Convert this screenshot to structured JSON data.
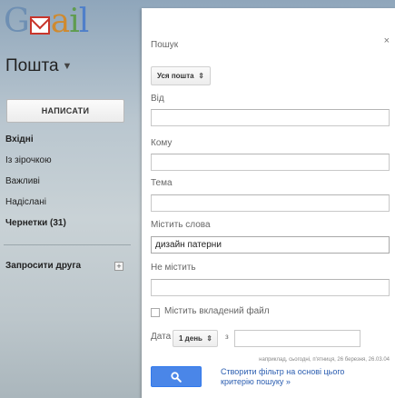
{
  "app": {
    "logo_text": "Gmail"
  },
  "sidebar": {
    "mail_switch_label": "Пошта",
    "compose_label": "НАПИСАТИ",
    "items": [
      {
        "label": "Вхідні",
        "bold": true
      },
      {
        "label": "Із зірочкою",
        "bold": false
      },
      {
        "label": "Важливі",
        "bold": false
      },
      {
        "label": "Надіслані",
        "bold": false
      },
      {
        "label": "Чернетки (31)",
        "bold": true
      }
    ],
    "invite_label": "Запросити друга",
    "invite_plus": "+"
  },
  "search_panel": {
    "close_glyph": "×",
    "search_label": "Пошук",
    "scope_value": "Уся пошта",
    "from_label": "Від",
    "from_value": "",
    "to_label": "Кому",
    "to_value": "",
    "subject_label": "Тема",
    "subject_value": "",
    "has_words_label": "Містить слова",
    "has_words_value": "дизайн патерни",
    "not_has_label": "Не містить",
    "not_has_value": "",
    "has_attachment_label": "Містить вкладений файл",
    "has_attachment_checked": false,
    "date_label": "Дата",
    "date_range_value": "1 день",
    "date_preposition": "з",
    "date_value": "",
    "date_hint": "наприклад, сьогодні, п'ятниця, 26 березня, 26.03.04",
    "create_filter_link": "Створити фільтр на основі цього критерію пошуку »",
    "search_button_icon": "search-icon"
  },
  "colors": {
    "search_button": "#4a86e8",
    "link": "#2a5db0",
    "gmail_red": "#c8352b"
  }
}
